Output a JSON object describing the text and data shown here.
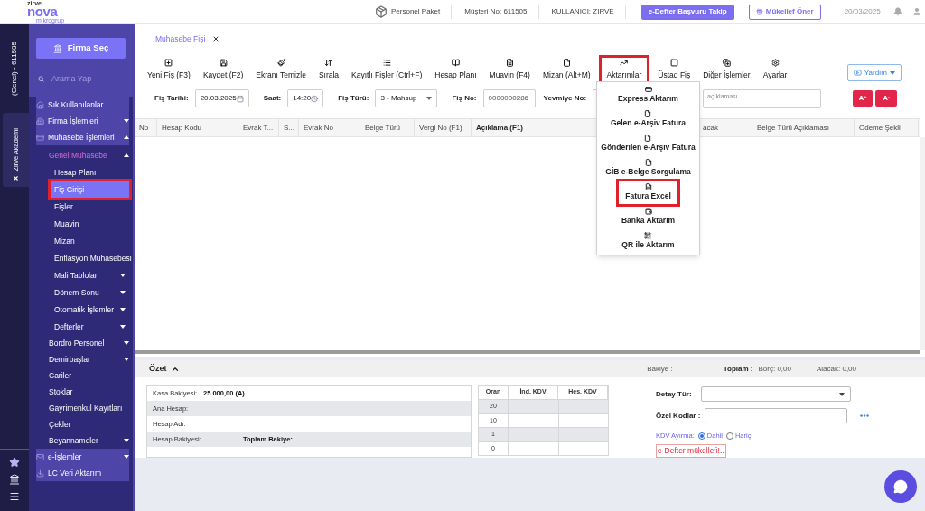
{
  "logo": {
    "small": "zirve",
    "brand": "nova",
    "sub": "mikrogrup"
  },
  "header": {
    "package": "Personel Paket",
    "customer": "Müşteri No: 611505",
    "user": "KULLANICI: ZIRVE",
    "apply_button": "e-Defter Başvuru Takip",
    "refer_button": "Mükellef Öner",
    "date": "20/03/2025"
  },
  "rail": {
    "account": "(Genel) - 611505",
    "academy_tab": "Zirve Akademi"
  },
  "sidebar": {
    "firm_button": "Firma Seç",
    "search_placeholder": "Arama Yap",
    "items": [
      {
        "label": "Sık Kullanılanlar",
        "selected": false
      },
      {
        "label": "Firma İşlemleri",
        "selected": false,
        "expanded": false
      },
      {
        "label": "Muhasebe İşlemleri",
        "selected": false,
        "expanded": true,
        "children": [
          {
            "label": "Genel Muhasebe",
            "selected": false,
            "expanded": true,
            "children": [
              {
                "label": "Hesap Planı",
                "selected": false
              },
              {
                "label": "Fiş Girişi",
                "selected": true,
                "highlighted": true
              },
              {
                "label": "Fişler",
                "selected": false
              },
              {
                "label": "Muavin",
                "selected": false
              },
              {
                "label": "Mizan",
                "selected": false
              },
              {
                "label": "Enflasyon Muhasebesi",
                "selected": false
              },
              {
                "label": "Mali Tablolar",
                "selected": false,
                "expanded": false
              },
              {
                "label": "Dönem Sonu",
                "selected": false,
                "expanded": false
              },
              {
                "label": "Otomatik İşlemler",
                "selected": false,
                "expanded": false
              },
              {
                "label": "Defterler",
                "selected": false,
                "expanded": false
              }
            ]
          },
          {
            "label": "Bordro Personel",
            "selected": false,
            "expanded": false
          },
          {
            "label": "Demirbaşlar",
            "selected": false,
            "expanded": false
          },
          {
            "label": "Cariler",
            "selected": false
          },
          {
            "label": "Stoklar",
            "selected": false
          },
          {
            "label": "Gayrimenkul Kayıtları",
            "selected": false
          },
          {
            "label": "Çekler",
            "selected": false
          },
          {
            "label": "Beyannameler",
            "selected": false,
            "expanded": false
          }
        ]
      },
      {
        "label": "e-İşlemler",
        "selected": false,
        "expanded": false
      },
      {
        "label": "LC Veri Aktarım",
        "selected": false
      }
    ]
  },
  "doc_tab": "Muhasebe Fişi",
  "toolbar": [
    {
      "label": "Yeni Fiş (F3)",
      "highlighted": false
    },
    {
      "label": "Kaydet (F2)",
      "highlighted": false
    },
    {
      "label": "Ekranı Temizle",
      "highlighted": false
    },
    {
      "label": "Sırala",
      "highlighted": false
    },
    {
      "label": "Kayıtlı Fişler (Ctrl+F)",
      "highlighted": false
    },
    {
      "label": "Hesap Planı",
      "highlighted": false
    },
    {
      "label": "Muavin (F4)",
      "highlighted": false
    },
    {
      "label": "Mizan (Alt+M)",
      "highlighted": false
    },
    {
      "label": "Aktarımlar",
      "highlighted": true
    },
    {
      "label": "Üstad Fiş",
      "highlighted": false
    },
    {
      "label": "Diğer İşlemler",
      "highlighted": false
    },
    {
      "label": "Ayarlar",
      "highlighted": false
    }
  ],
  "import_menu": [
    {
      "label": "Express Aktarım",
      "highlighted": false
    },
    {
      "label": "Gelen e-Arşiv Fatura",
      "highlighted": false
    },
    {
      "label": "Gönderilen e-Arşiv Fatura",
      "highlighted": false
    },
    {
      "label": "GİB e-Belge Sorgulama",
      "highlighted": false
    },
    {
      "label": "Fatura Excel",
      "highlighted": true
    },
    {
      "label": "Banka Aktarım",
      "highlighted": false
    },
    {
      "label": "QR ile Aktarım",
      "highlighted": false
    }
  ],
  "help_button": "Yardım",
  "font_buttons": [
    "A$^{+}$",
    "A$^{-}$"
  ],
  "form": {
    "fields": [
      {
        "kind": "date",
        "label": "Fiş Tarihi:",
        "value": "20.03.2025"
      },
      {
        "kind": "time",
        "label": "Saat:",
        "value": "14:20"
      },
      {
        "kind": "select",
        "label": "Fiş Türü:",
        "value": "3 - Mahsup"
      },
      {
        "kind": "text",
        "label": "Fiş No:",
        "value": "0000000286"
      },
      {
        "kind": "text",
        "label": "Yevmiye No:"
      }
    ],
    "description_placeholder": "açıklaması..."
  },
  "table": {
    "columns": [
      "No",
      "Hesap Kodu",
      "Evrak T...",
      "S...",
      "Evrak No",
      "Belge Türü",
      "Vergi No (F1)",
      "Açıklama (F1)",
      "acak",
      "Belge Türü Açıklaması",
      "Ödeme Şekli"
    ]
  },
  "summary": {
    "title": "Özet",
    "expanded": true,
    "balance": "Bakiye :",
    "total": "Toplam :",
    "debit": "Borç: 0,00",
    "credit": "Alacak: 0,00",
    "account_rows": [
      {
        "label": "Kasa Bakiyesi:",
        "value": "25.000,00 (A)"
      },
      {
        "label": "Ana Hesap:"
      },
      {
        "label": "Hesap Adı:"
      },
      {
        "label": "Hesap Bakiyesi:",
        "value": "Toplam Bakiye:"
      }
    ],
    "kdv_table": {
      "columns": [
        "Oran",
        "İnd. KDV",
        "Hes. KDV"
      ],
      "rows": [
        "20",
        "10",
        "1",
        "0"
      ]
    },
    "detail_type": "Detay Tür:",
    "special_codes": "Özel Kodlar :",
    "kdv_split": {
      "label": "KDV Ayırma:",
      "options": [
        {
          "label": "Dahil",
          "selected": true
        },
        {
          "label": "Hariç",
          "selected": false
        }
      ]
    },
    "warning": "e-Defter mükellefi!.."
  }
}
